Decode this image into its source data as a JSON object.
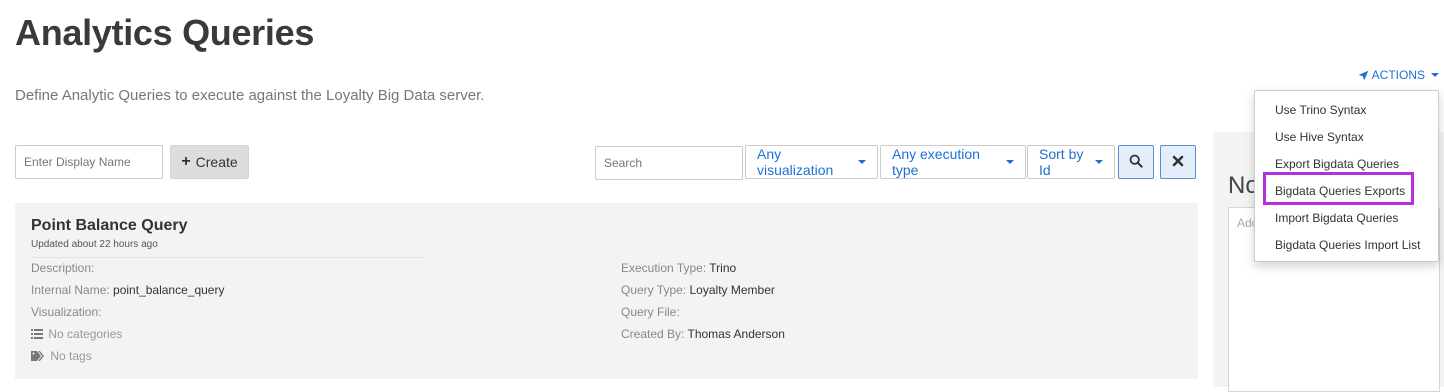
{
  "page": {
    "title": "Analytics Queries",
    "description": "Define Analytic Queries to execute against the Loyalty Big Data server."
  },
  "actions": {
    "label": "ACTIONS",
    "icon": "rocket-icon",
    "menu": [
      "Use Trino Syntax",
      "Use Hive Syntax",
      "Export Bigdata Queries",
      "Bigdata Queries Exports",
      "Import Bigdata Queries",
      "Bigdata Queries Import List"
    ],
    "highlighted_item": "Bigdata Queries Exports",
    "highlight_color": "#b52ee0"
  },
  "create_form": {
    "display_name_placeholder": "Enter Display Name",
    "create_label": "Create"
  },
  "filters": {
    "search_placeholder": "Search",
    "visualization": "Any visualization",
    "execution_type": "Any execution type",
    "sort": "Sort by Id",
    "search_button_icon": "search-icon",
    "clear_button_icon": "close-icon"
  },
  "query": {
    "title": "Point Balance Query",
    "updated": "Updated about 22 hours ago",
    "description_label": "Description:",
    "internal_name_label": "Internal Name:",
    "internal_name": "point_balance_query",
    "visualization_label": "Visualization:",
    "categories": "No categories",
    "tags": "No tags",
    "execution_type_label": "Execution Type:",
    "execution_type": "Trino",
    "query_type_label": "Query Type:",
    "query_type": "Loyalty Member",
    "query_file_label": "Query File:",
    "created_by_label": "Created By:",
    "created_by": "Thomas Anderson"
  },
  "side_panel": {
    "heading": "No",
    "textarea_placeholder": "Ado"
  },
  "colors": {
    "accent": "#1f6fd6",
    "card_bg": "#f3f3f3"
  }
}
